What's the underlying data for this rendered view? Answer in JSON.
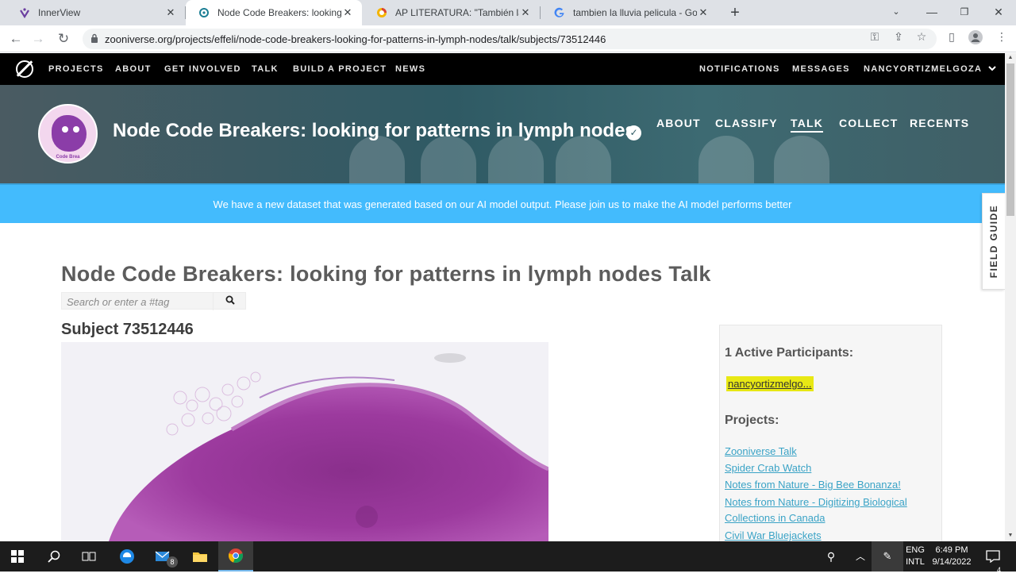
{
  "browser": {
    "tabs": [
      {
        "title": "InnerView",
        "favicon": "innerview-icon",
        "active": false
      },
      {
        "title": "Node Code Breakers: looking for",
        "favicon": "zooniverse-icon",
        "active": true
      },
      {
        "title": "AP LITERATURA: \"También la lluvi",
        "favicon": "classroom-icon",
        "active": false
      },
      {
        "title": "tambien la lluvia pelicula - Googl",
        "favicon": "google-icon",
        "active": false
      }
    ],
    "url": "zooniverse.org/projects/effeli/node-code-breakers-looking-for-patterns-in-lymph-nodes/talk/subjects/73512446"
  },
  "zooniverse_nav": {
    "left": [
      "PROJECTS",
      "ABOUT",
      "GET INVOLVED",
      "TALK",
      "BUILD A PROJECT",
      "NEWS"
    ],
    "right": [
      "NOTIFICATIONS",
      "MESSAGES",
      "NANCYORTIZMELGOZA"
    ]
  },
  "project": {
    "title": "Node Code Breakers: looking for patterns in lymph nodes",
    "avatar_label": "Code Brea",
    "nav": [
      "ABOUT",
      "CLASSIFY",
      "TALK",
      "COLLECT",
      "RECENTS"
    ],
    "active_nav": "TALK"
  },
  "announcement": "We have a new dataset that was generated based on our AI model output. Please join us to make the AI model performs better",
  "field_guide_label": "FIELD GUIDE",
  "talk": {
    "title": "Node Code Breakers: looking for patterns in lymph nodes Talk",
    "search_placeholder": "Search or enter a #tag",
    "subject_title": "Subject 73512446"
  },
  "sidebar": {
    "participants_heading": "1 Active Participants:",
    "participant": "nancyortizmelgo...",
    "projects_heading": "Projects:",
    "projects": [
      "Zooniverse Talk",
      "Spider Crab Watch",
      "Notes from Nature - Big Bee Bonanza!",
      "Notes from Nature - Digitizing Biological",
      "Collections in Canada",
      "Civil War Bluejackets"
    ]
  },
  "taskbar": {
    "mail_badge": "8",
    "lang": "ENG",
    "lang_sub": "INTL",
    "time": "6:49 PM",
    "date": "9/14/2022",
    "notif_count": "4"
  }
}
